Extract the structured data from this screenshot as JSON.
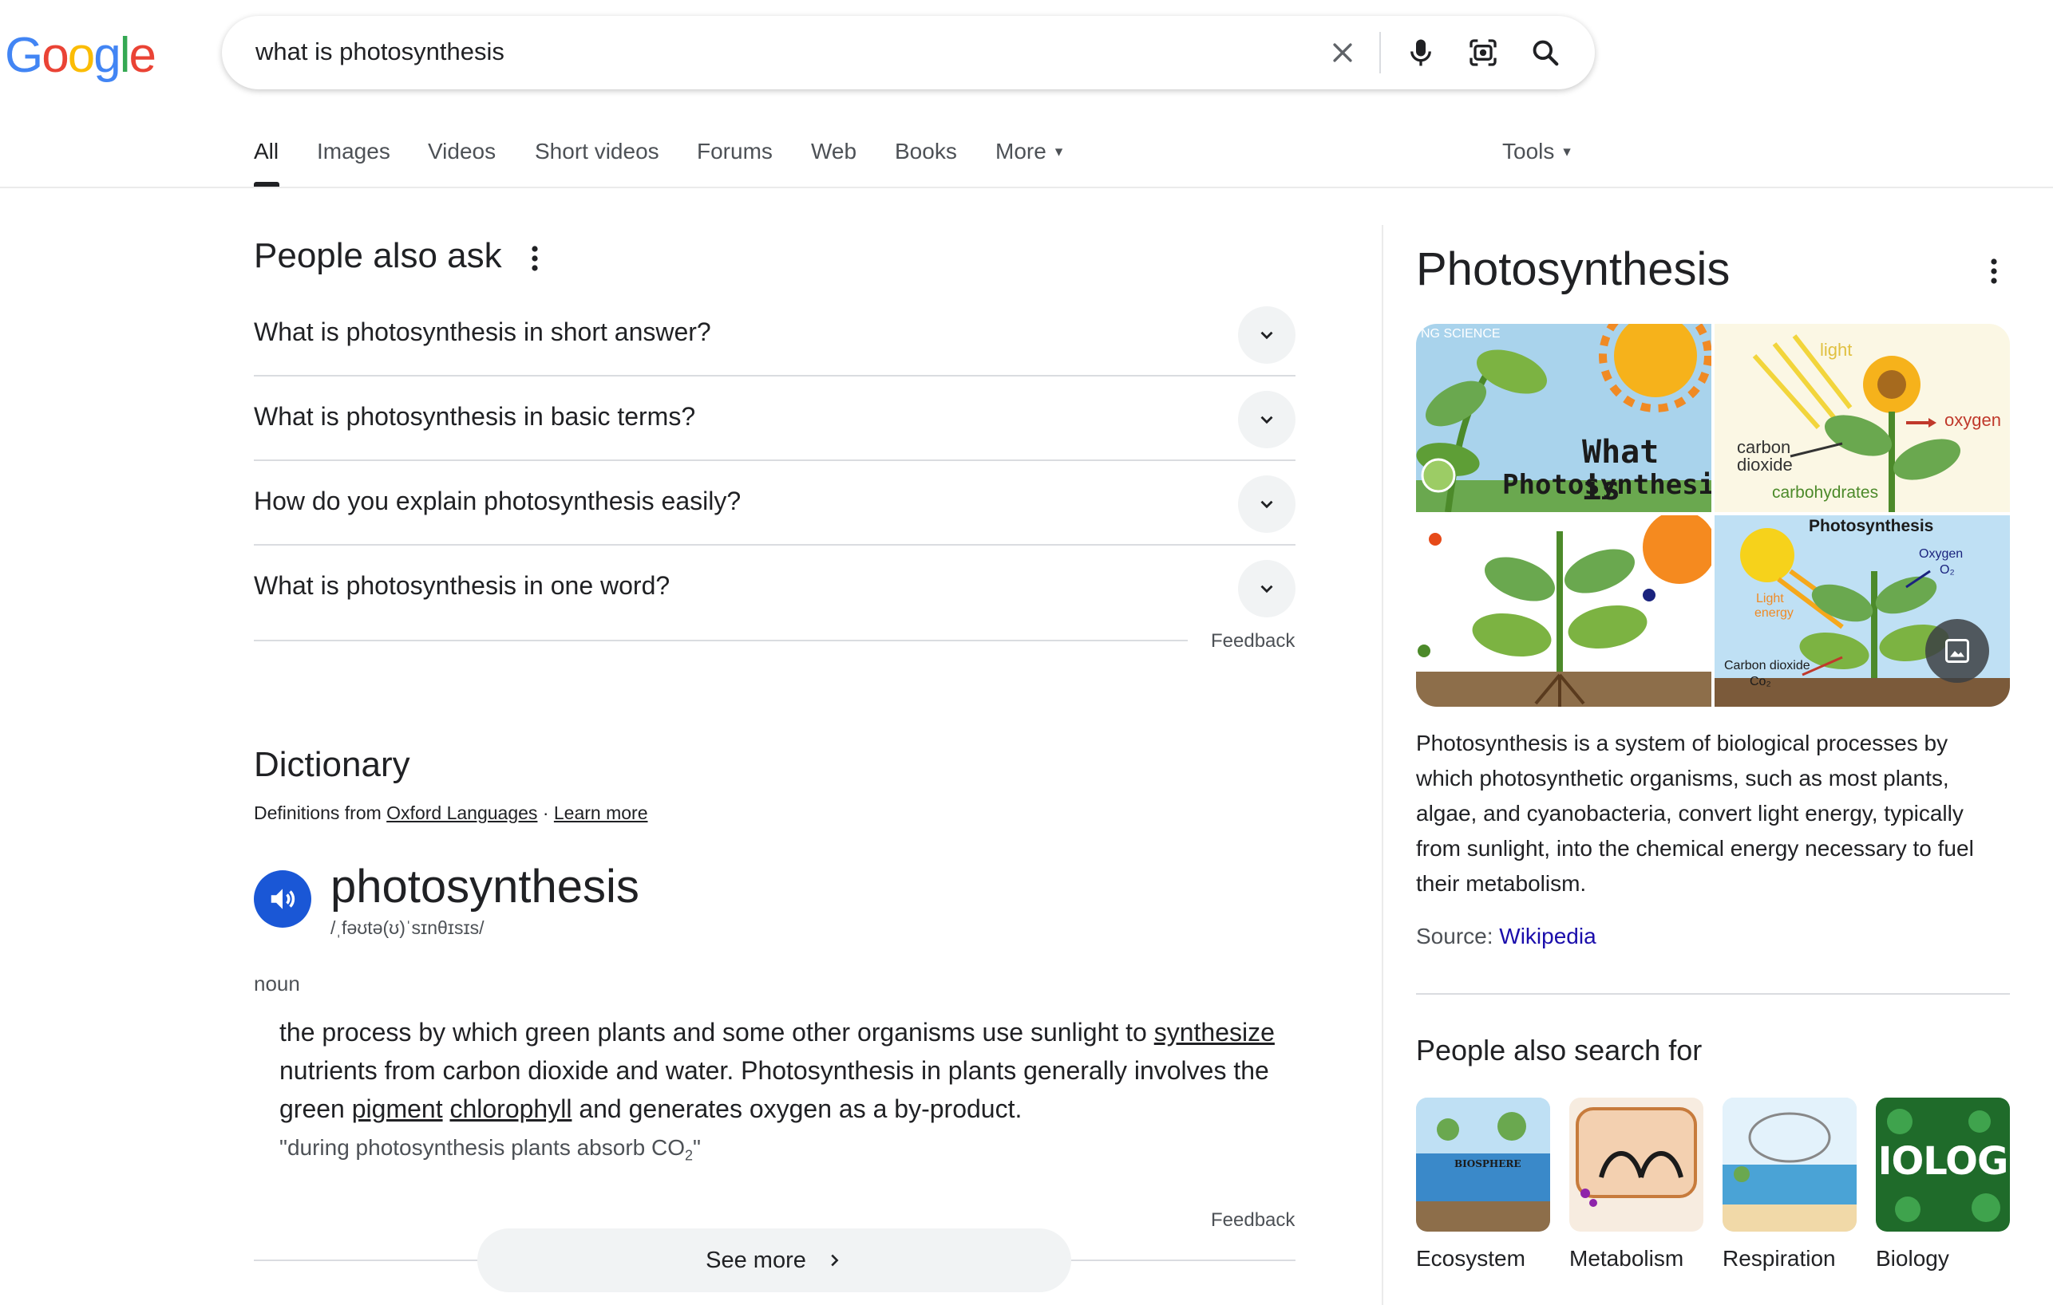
{
  "logo": {
    "letters": [
      "G",
      "o",
      "o",
      "g",
      "l",
      "e"
    ],
    "colors": [
      "#4285F4",
      "#EA4335",
      "#FBBC05",
      "#4285F4",
      "#34A853",
      "#EA4335"
    ]
  },
  "search": {
    "query": "what is photosynthesis",
    "icons": [
      "close-icon",
      "microphone-icon",
      "camera-lens-icon",
      "search-icon"
    ]
  },
  "tabs": [
    {
      "label": "All",
      "active": true
    },
    {
      "label": "Images"
    },
    {
      "label": "Videos"
    },
    {
      "label": "Short videos"
    },
    {
      "label": "Forums"
    },
    {
      "label": "Web"
    },
    {
      "label": "Books"
    },
    {
      "label": "More"
    }
  ],
  "tools_label": "Tools",
  "people_also_ask": {
    "title": "People also ask",
    "questions": [
      "What is photosynthesis in short answer?",
      "What is photosynthesis in basic terms?",
      "How do you explain photosynthesis easily?",
      "What is photosynthesis in one word?"
    ],
    "feedback": "Feedback"
  },
  "dictionary": {
    "title": "Dictionary",
    "source_prefix": "Definitions from",
    "source_link": "Oxford Languages",
    "separator": "·",
    "learn_more": "Learn more",
    "word": "photosynthesis",
    "phonetic": "/ˌfəʊtə(ʊ)ˈsɪnθɪsɪs/",
    "part_of_speech": "noun",
    "definition_1": "the process by which green plants and some other organisms use sunlight to ",
    "definition_link_1": "synthesize",
    "definition_2": " nutrients from carbon dioxide and water. Photosynthesis in plants generally involves the green ",
    "definition_link_2": "pigment",
    "definition_space": " ",
    "definition_link_3": "chlorophyll",
    "definition_3": " and generates oxygen as a by-product.",
    "example_1": "\"during photosynthesis plants absorb CO",
    "example_sub": "2",
    "example_2": "\"",
    "feedback": "Feedback",
    "see_more": "See more"
  },
  "knowledge_panel": {
    "title": "Photosynthesis",
    "image_labels": {
      "tile1_line1": "What is",
      "tile1_line2": "Photosynthesis?",
      "tile1_corner": "NG SCIENCE",
      "tile2_light": "light",
      "tile2_oxygen": "oxygen",
      "tile2_carbon": "carbon",
      "tile2_dioxide": "dioxide",
      "tile2_carbs": "carbohydrates",
      "tile4_title": "Photosynthesis",
      "tile4_oxygen": "Oxygen",
      "tile4_o2": "O₂",
      "tile4_light": "Light",
      "tile4_energy": "energy",
      "tile4_co2": "Carbon dioxide",
      "tile4_co2_formula": "Co₂"
    },
    "description": "Photosynthesis is a system of biological processes by which photosynthetic organisms, such as most plants, algae, and cyanobacteria, convert light energy, typically from sunlight, into the chemical energy necessary to fuel their metabolism.",
    "source_label": "Source:",
    "source_link": "Wikipedia",
    "people_also_search_title": "People also search for",
    "people_also_search": [
      {
        "label": "Ecosystem",
        "thumb_text": "BIOSPHERE"
      },
      {
        "label": "Metabolism",
        "thumb_text": ""
      },
      {
        "label": "Respiration",
        "thumb_text": ""
      },
      {
        "label": "Biology",
        "thumb_text": "IOLOG"
      }
    ]
  }
}
